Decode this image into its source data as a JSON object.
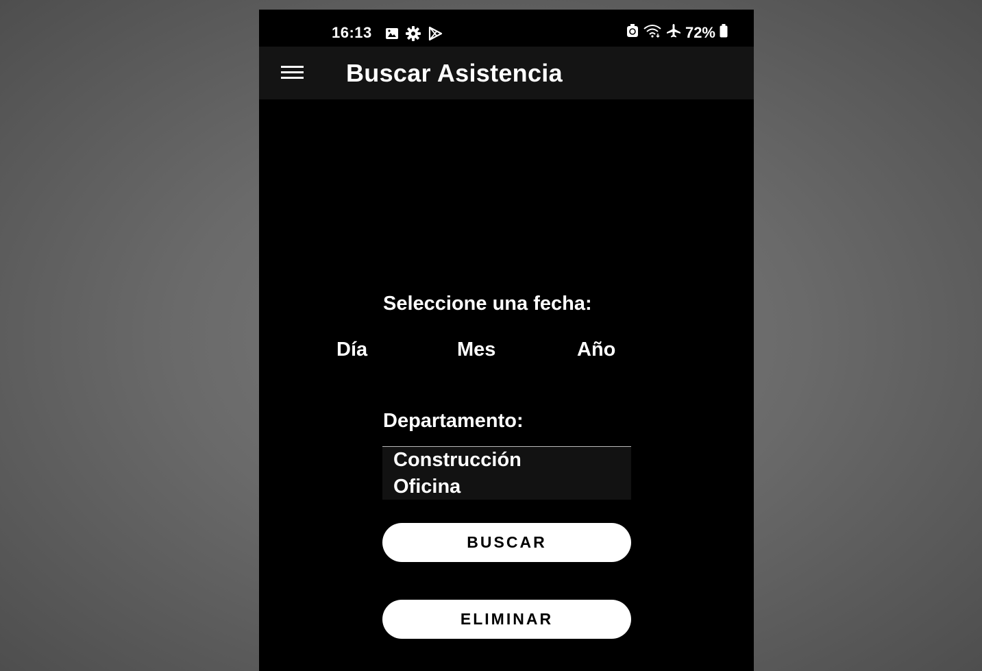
{
  "status_bar": {
    "time": "16:13",
    "left_icons": [
      "image-icon",
      "gear-icon",
      "play-store-icon"
    ],
    "right_icons": [
      "battery-saver-icon",
      "wifi-icon",
      "airplane-icon",
      "battery-icon"
    ],
    "battery_percent": "72%"
  },
  "appbar": {
    "menu_icon": "hamburger-menu-icon",
    "title": "Buscar Asistencia"
  },
  "date_section": {
    "label": "Seleccione una fecha:",
    "day": "Día",
    "month": "Mes",
    "year": "Año"
  },
  "department_section": {
    "label": "Departamento:",
    "options": [
      "Construcción",
      "Oficina"
    ]
  },
  "buttons": {
    "search": "BUSCAR",
    "delete": "ELIMINAR"
  },
  "colors": {
    "phone_background": "#000000",
    "appbar_background": "#141414",
    "button_background": "#ffffff",
    "text": "#ffffff"
  }
}
